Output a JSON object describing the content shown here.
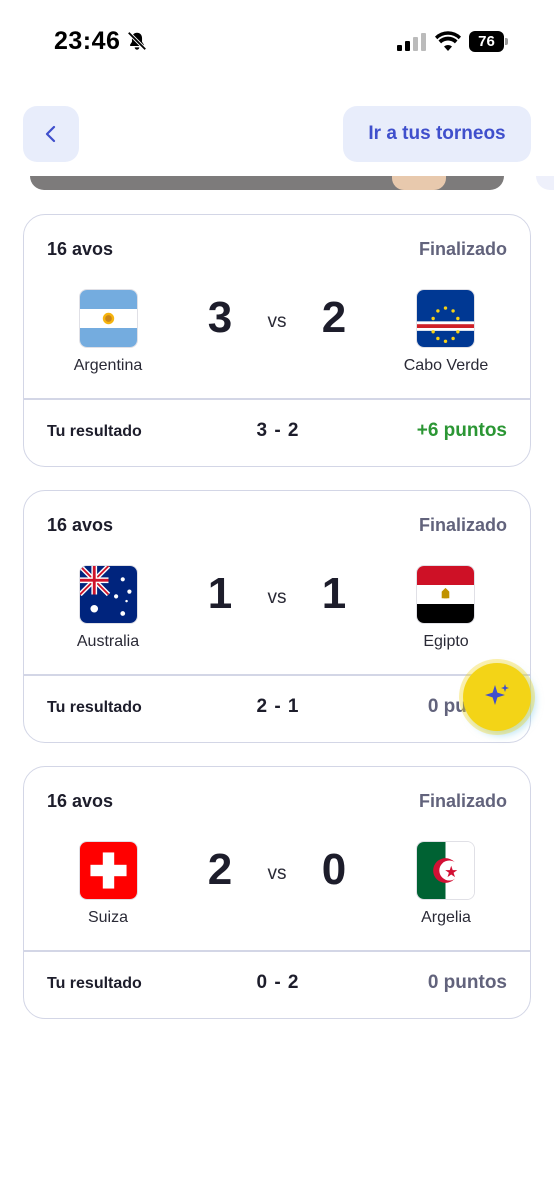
{
  "status_bar": {
    "time": "23:46",
    "battery": "76"
  },
  "nav": {
    "back_icon": "chevron-left-icon",
    "tournaments_label": "Ir a tus torneos"
  },
  "matches": [
    {
      "round": "16 avos",
      "status": "Finalizado",
      "home": {
        "name": "Argentina",
        "score": "3",
        "flag": "argentina"
      },
      "vs": "vs",
      "away": {
        "name": "Cabo Verde",
        "score": "2",
        "flag": "cabo-verde"
      },
      "your_label": "Tu resultado",
      "your_score": "3 - 2",
      "points": "+6 puntos"
    },
    {
      "round": "16 avos",
      "status": "Finalizado",
      "home": {
        "name": "Australia",
        "score": "1",
        "flag": "australia"
      },
      "vs": "vs",
      "away": {
        "name": "Egipto",
        "score": "1",
        "flag": "egipto"
      },
      "your_label": "Tu resultado",
      "your_score": "2 - 1",
      "points": "0 puntos"
    },
    {
      "round": "16 avos",
      "status": "Finalizado",
      "home": {
        "name": "Suiza",
        "score": "2",
        "flag": "suiza"
      },
      "vs": "vs",
      "away": {
        "name": "Argelia",
        "score": "0",
        "flag": "argelia"
      },
      "your_label": "Tu resultado",
      "your_score": "0 - 2",
      "points": "0 puntos"
    }
  ],
  "colors": {
    "accent": "#3f4fcc",
    "positive": "#2b9634",
    "muted": "#62637c",
    "fab": "#f3d417"
  }
}
